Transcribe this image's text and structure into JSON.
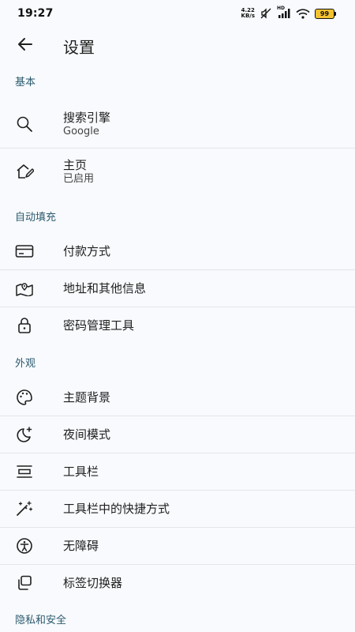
{
  "status_bar": {
    "time": "19:27",
    "net_speed_value": "4.22",
    "net_speed_unit": "KB/s",
    "network_label": "HD",
    "battery": "99"
  },
  "app_bar": {
    "title": "设置"
  },
  "sections": {
    "basic": {
      "header": "基本",
      "search_engine": {
        "title": "搜索引擎",
        "subtitle": "Google"
      },
      "homepage": {
        "title": "主页",
        "subtitle": "已启用"
      }
    },
    "autofill": {
      "header": "自动填充",
      "payment": {
        "title": "付款方式"
      },
      "addresses": {
        "title": "地址和其他信息"
      },
      "passwords": {
        "title": "密码管理工具"
      }
    },
    "appearance": {
      "header": "外观",
      "theme": {
        "title": "主题背景"
      },
      "night_mode": {
        "title": "夜间模式"
      },
      "toolbar": {
        "title": "工具栏"
      },
      "toolbar_shortcut": {
        "title": "工具栏中的快捷方式"
      },
      "accessibility": {
        "title": "无障碍"
      },
      "tab_switcher": {
        "title": "标签切换器"
      }
    },
    "privacy": {
      "header": "隐私和安全"
    }
  },
  "icons": {
    "back": "arrow-left-icon",
    "search": "search-icon",
    "home": "home-edit-icon",
    "payment": "credit-card-icon",
    "address": "map-pin-icon",
    "password": "lock-icon",
    "theme": "palette-icon",
    "night": "moon-icon",
    "toolbar": "toolbar-icon",
    "shortcut": "magic-wand-icon",
    "accessibility": "accessibility-icon",
    "tabs": "tab-switcher-icon"
  },
  "colors": {
    "background": "#f8fafd",
    "section_header": "#2b5a6e",
    "divider": "#e2e5ea",
    "battery": "#f2c230"
  }
}
